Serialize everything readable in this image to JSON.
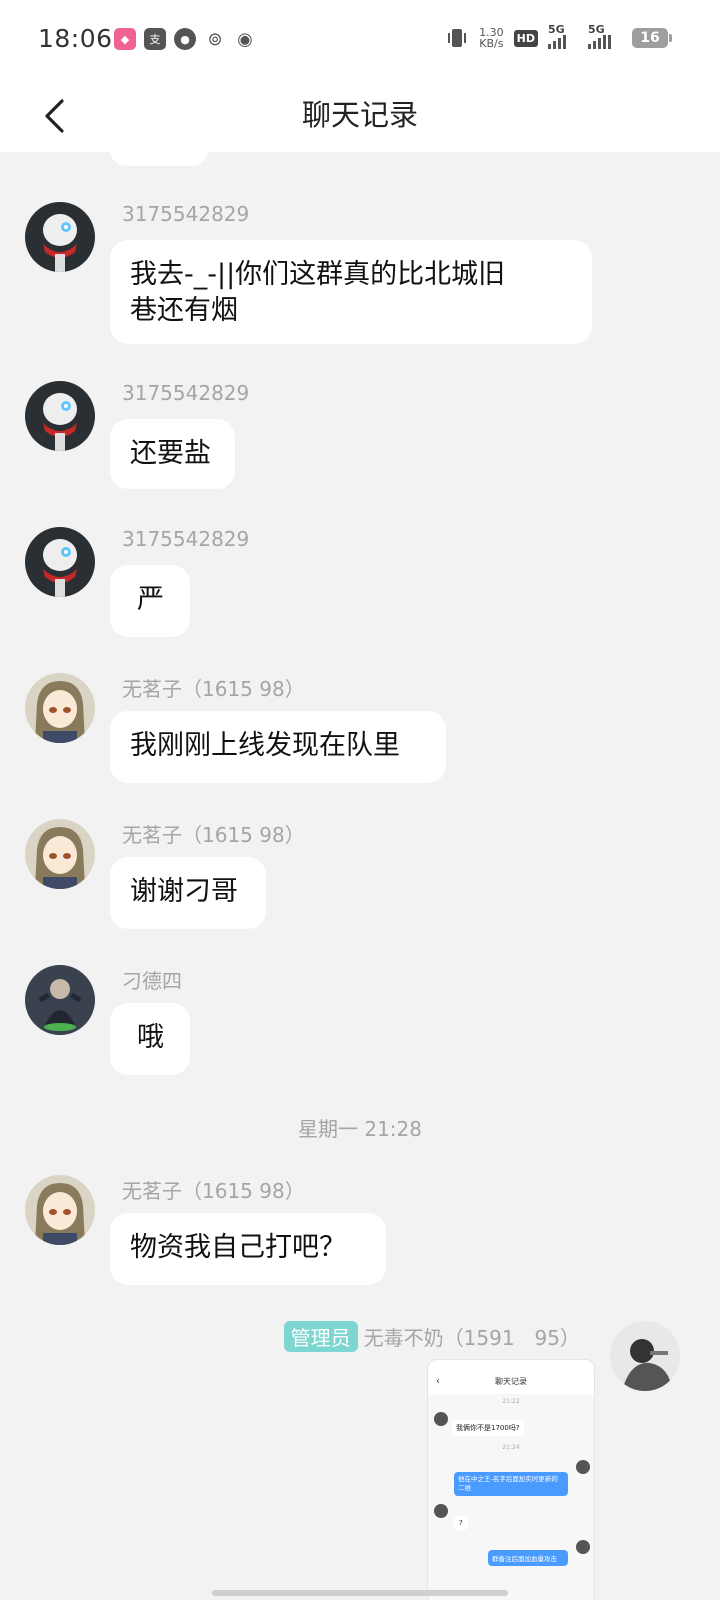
{
  "status_bar": {
    "time": "18:06",
    "net_speed_value": "1.30",
    "net_speed_unit": "KB/s",
    "hd": "HD",
    "sim1": "1",
    "sim2": "2",
    "signal1": "5G",
    "signal2": "5G",
    "battery": "16"
  },
  "header": {
    "title": "聊天记录"
  },
  "messages": [
    {
      "sender": "3175542829",
      "text_line1": "我去-_-||你们这群真的比北城旧",
      "text_line2": "巷还有烟"
    },
    {
      "sender": "3175542829",
      "text": "还要盐"
    },
    {
      "sender": "3175542829",
      "text": "严"
    },
    {
      "sender": "无茗子（1615 98）",
      "text": "我刚刚上线发现在队里"
    },
    {
      "sender": "无茗子（1615 98）",
      "text": "谢谢刁哥"
    },
    {
      "sender": "刁德四",
      "text": "哦"
    },
    {
      "sender": "无茗子（1615 98）",
      "text": "物资我自己打吧？"
    }
  ],
  "time_separator": "星期一 21:28",
  "own_message": {
    "badge": "管理员",
    "sender": "无毒不奶（1591　95）"
  },
  "screenshot_content": {
    "title": "聊天记录",
    "time1": "21:22",
    "msg1": "我俩你不是1700吗?",
    "time2": "21:24",
    "msg2": "他在中之王-名字后面加实时更新的二维",
    "msg3": "?",
    "msg4": "群备注后面加血量攻击"
  }
}
